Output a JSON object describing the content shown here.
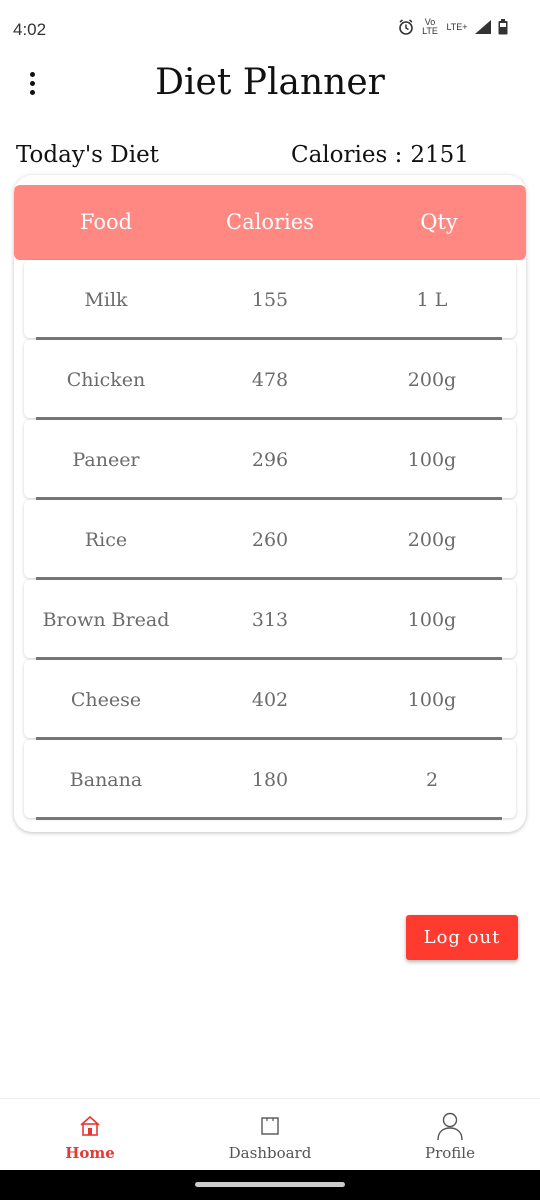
{
  "status_bar": {
    "time": "4:02",
    "volte": "Vo LTE",
    "network": "LTE+"
  },
  "header": {
    "title": "Diet Planner"
  },
  "summary": {
    "label": "Today's Diet",
    "calories_label": "Calories :",
    "calories_value": "2151"
  },
  "table": {
    "columns": [
      "Food",
      "Calories",
      "Qty"
    ],
    "rows": [
      {
        "food": "Milk",
        "calories": "155",
        "qty": "1 L"
      },
      {
        "food": "Chicken",
        "calories": "478",
        "qty": "200g"
      },
      {
        "food": "Paneer",
        "calories": "296",
        "qty": "100g"
      },
      {
        "food": "Rice",
        "calories": "260",
        "qty": "200g"
      },
      {
        "food": "Brown Bread",
        "calories": "313",
        "qty": "100g"
      },
      {
        "food": "Cheese",
        "calories": "402",
        "qty": "100g"
      },
      {
        "food": "Banana",
        "calories": "180",
        "qty": "2"
      }
    ]
  },
  "actions": {
    "logout_label": "Log out"
  },
  "bottom_nav": {
    "items": [
      {
        "label": "Home",
        "icon": "home-icon",
        "active": true
      },
      {
        "label": "Dashboard",
        "icon": "dashboard-icon",
        "active": false
      },
      {
        "label": "Profile",
        "icon": "profile-icon",
        "active": false
      }
    ]
  },
  "colors": {
    "header_bg": "#ff8882",
    "logout_bg": "#ff3b30",
    "active_nav": "#e53935"
  }
}
